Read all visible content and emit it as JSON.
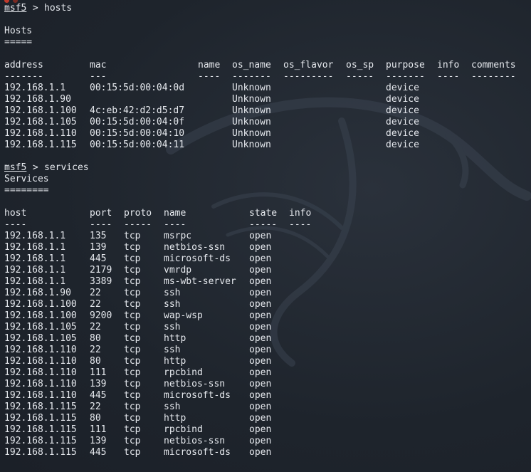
{
  "terminal": {
    "prompt": "msf5",
    "prompt_sep": " > ",
    "theme": {
      "background": "#1f252e",
      "foreground": "#e6e9ee"
    }
  },
  "hosts_block": {
    "command": "hosts",
    "title": "Hosts",
    "underline": "=====",
    "columns": [
      "address",
      "mac",
      "name",
      "os_name",
      "os_flavor",
      "os_sp",
      "purpose",
      "info",
      "comments"
    ],
    "separators": [
      "-------",
      "---",
      "----",
      "-------",
      "---------",
      "-----",
      "-------",
      "----",
      "--------"
    ],
    "rows": [
      [
        "192.168.1.1",
        "00:15:5d:00:04:0d",
        "",
        "Unknown",
        "",
        "",
        "device",
        "",
        ""
      ],
      [
        "192.168.1.90",
        "",
        "",
        "Unknown",
        "",
        "",
        "device",
        "",
        ""
      ],
      [
        "192.168.1.100",
        "4c:eb:42:d2:d5:d7",
        "",
        "Unknown",
        "",
        "",
        "device",
        "",
        ""
      ],
      [
        "192.168.1.105",
        "00:15:5d:00:04:0f",
        "",
        "Unknown",
        "",
        "",
        "device",
        "",
        ""
      ],
      [
        "192.168.1.110",
        "00:15:5d:00:04:10",
        "",
        "Unknown",
        "",
        "",
        "device",
        "",
        ""
      ],
      [
        "192.168.1.115",
        "00:15:5d:00:04:11",
        "",
        "Unknown",
        "",
        "",
        "device",
        "",
        ""
      ]
    ]
  },
  "services_block": {
    "command": "services",
    "title": "Services",
    "underline": "========",
    "columns": [
      "host",
      "port",
      "proto",
      "name",
      "state",
      "info"
    ],
    "separators": [
      "----",
      "----",
      "-----",
      "----",
      "-----",
      "----"
    ],
    "rows": [
      [
        "192.168.1.1",
        "135",
        "tcp",
        "msrpc",
        "open",
        ""
      ],
      [
        "192.168.1.1",
        "139",
        "tcp",
        "netbios-ssn",
        "open",
        ""
      ],
      [
        "192.168.1.1",
        "445",
        "tcp",
        "microsoft-ds",
        "open",
        ""
      ],
      [
        "192.168.1.1",
        "2179",
        "tcp",
        "vmrdp",
        "open",
        ""
      ],
      [
        "192.168.1.1",
        "3389",
        "tcp",
        "ms-wbt-server",
        "open",
        ""
      ],
      [
        "192.168.1.90",
        "22",
        "tcp",
        "ssh",
        "open",
        ""
      ],
      [
        "192.168.1.100",
        "22",
        "tcp",
        "ssh",
        "open",
        ""
      ],
      [
        "192.168.1.100",
        "9200",
        "tcp",
        "wap-wsp",
        "open",
        ""
      ],
      [
        "192.168.1.105",
        "22",
        "tcp",
        "ssh",
        "open",
        ""
      ],
      [
        "192.168.1.105",
        "80",
        "tcp",
        "http",
        "open",
        ""
      ],
      [
        "192.168.1.110",
        "22",
        "tcp",
        "ssh",
        "open",
        ""
      ],
      [
        "192.168.1.110",
        "80",
        "tcp",
        "http",
        "open",
        ""
      ],
      [
        "192.168.1.110",
        "111",
        "tcp",
        "rpcbind",
        "open",
        ""
      ],
      [
        "192.168.1.110",
        "139",
        "tcp",
        "netbios-ssn",
        "open",
        ""
      ],
      [
        "192.168.1.110",
        "445",
        "tcp",
        "microsoft-ds",
        "open",
        ""
      ],
      [
        "192.168.1.115",
        "22",
        "tcp",
        "ssh",
        "open",
        ""
      ],
      [
        "192.168.1.115",
        "80",
        "tcp",
        "http",
        "open",
        ""
      ],
      [
        "192.168.1.115",
        "111",
        "tcp",
        "rpcbind",
        "open",
        ""
      ],
      [
        "192.168.1.115",
        "139",
        "tcp",
        "netbios-ssn",
        "open",
        ""
      ],
      [
        "192.168.1.115",
        "445",
        "tcp",
        "microsoft-ds",
        "open",
        ""
      ]
    ]
  },
  "background_icon": "kali-dragon-watermark-icon"
}
